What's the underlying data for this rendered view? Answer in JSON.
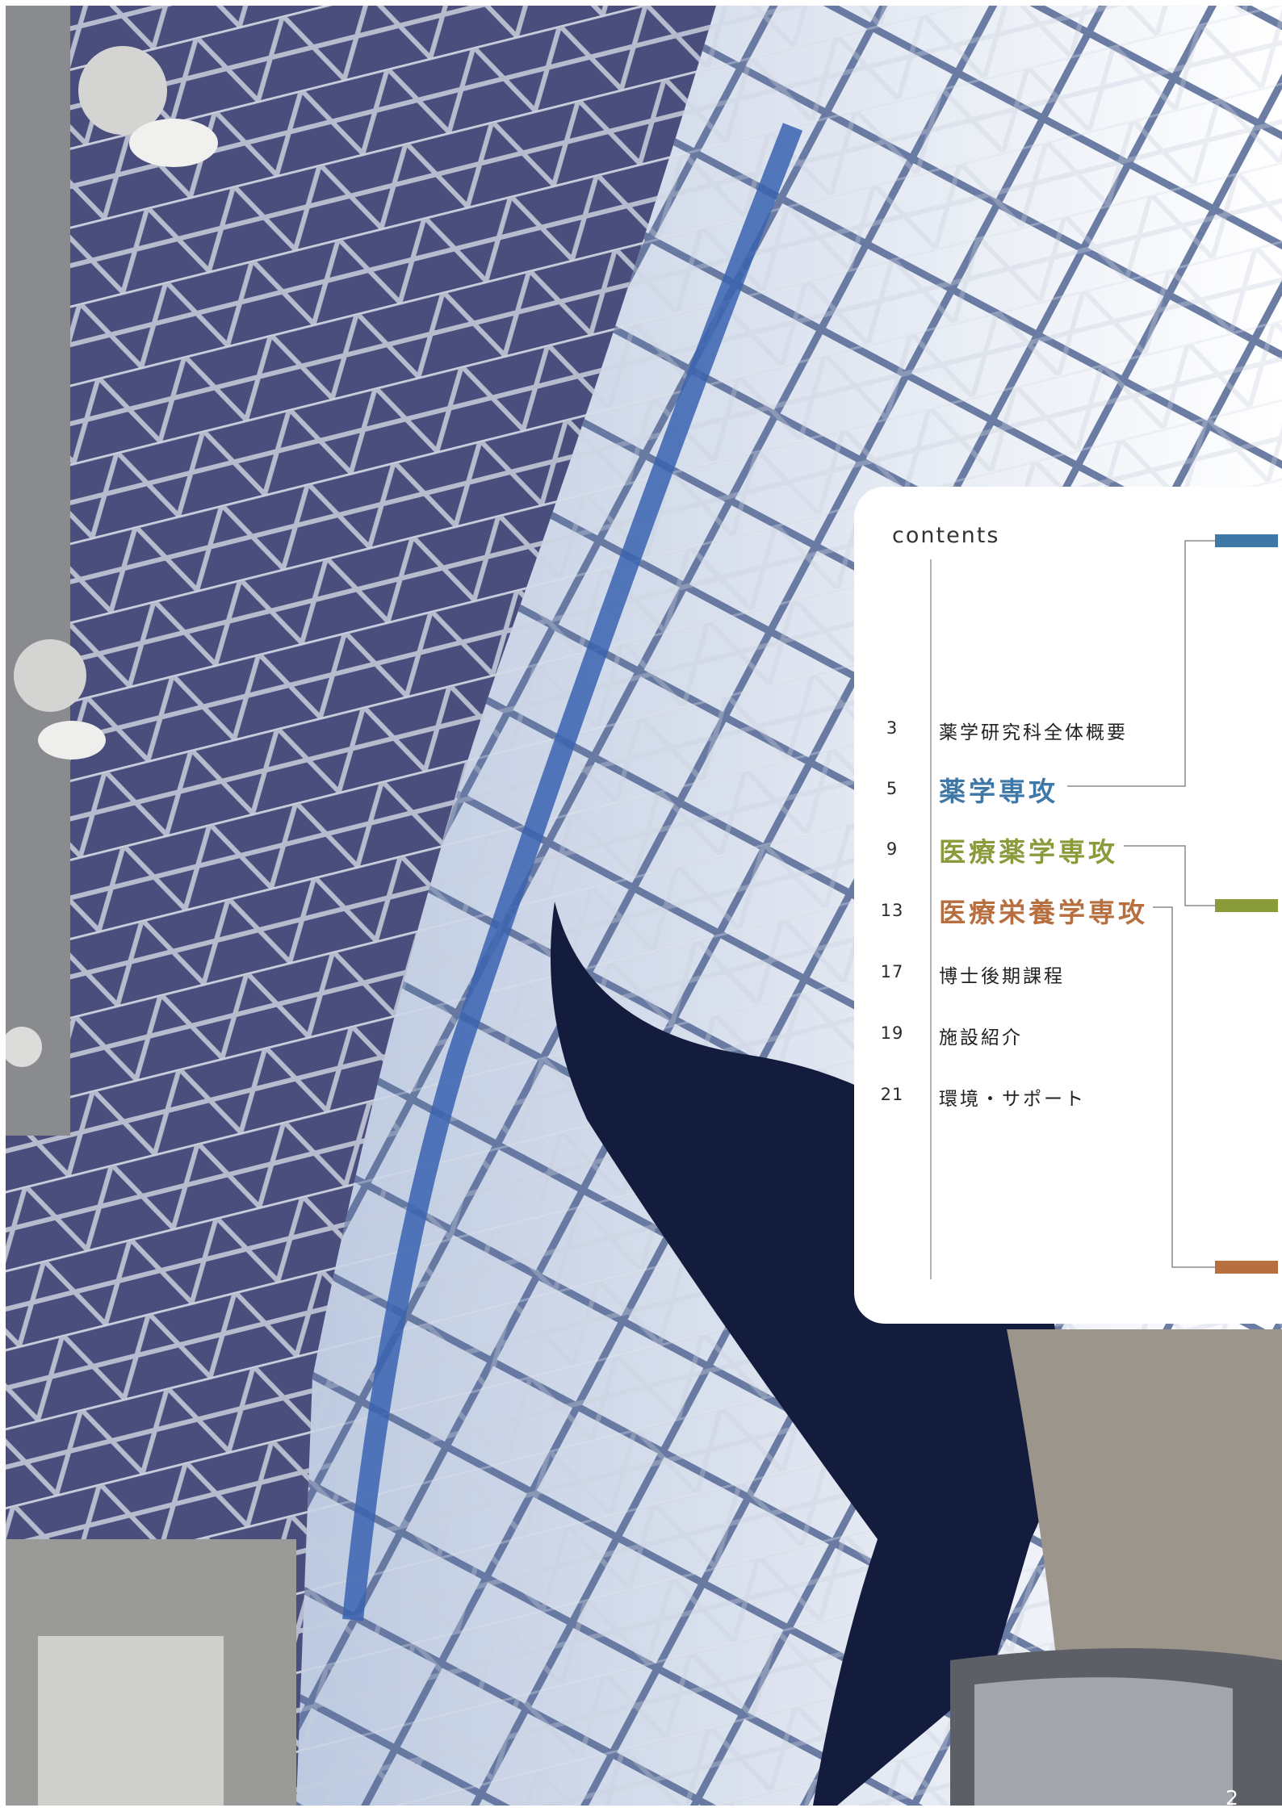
{
  "contents": {
    "title": "contents",
    "items": [
      {
        "page": "3",
        "label": "薬学研究科全体概要"
      },
      {
        "page": "5",
        "label": "薬学専攻",
        "color": "#3f77a7"
      },
      {
        "page": "9",
        "label": "医療薬学専攻",
        "color": "#8a9b3c"
      },
      {
        "page": "13",
        "label": "医療栄養学専攻",
        "color": "#b86f3f"
      },
      {
        "page": "17",
        "label": "博士後期課程"
      },
      {
        "page": "19",
        "label": "施設紹介"
      },
      {
        "page": "21",
        "label": "環境・サポート"
      }
    ]
  },
  "accent_colors": {
    "blue": "#3f77a7",
    "green": "#8a9b3c",
    "orange": "#b86f3f"
  },
  "page_number": "2"
}
